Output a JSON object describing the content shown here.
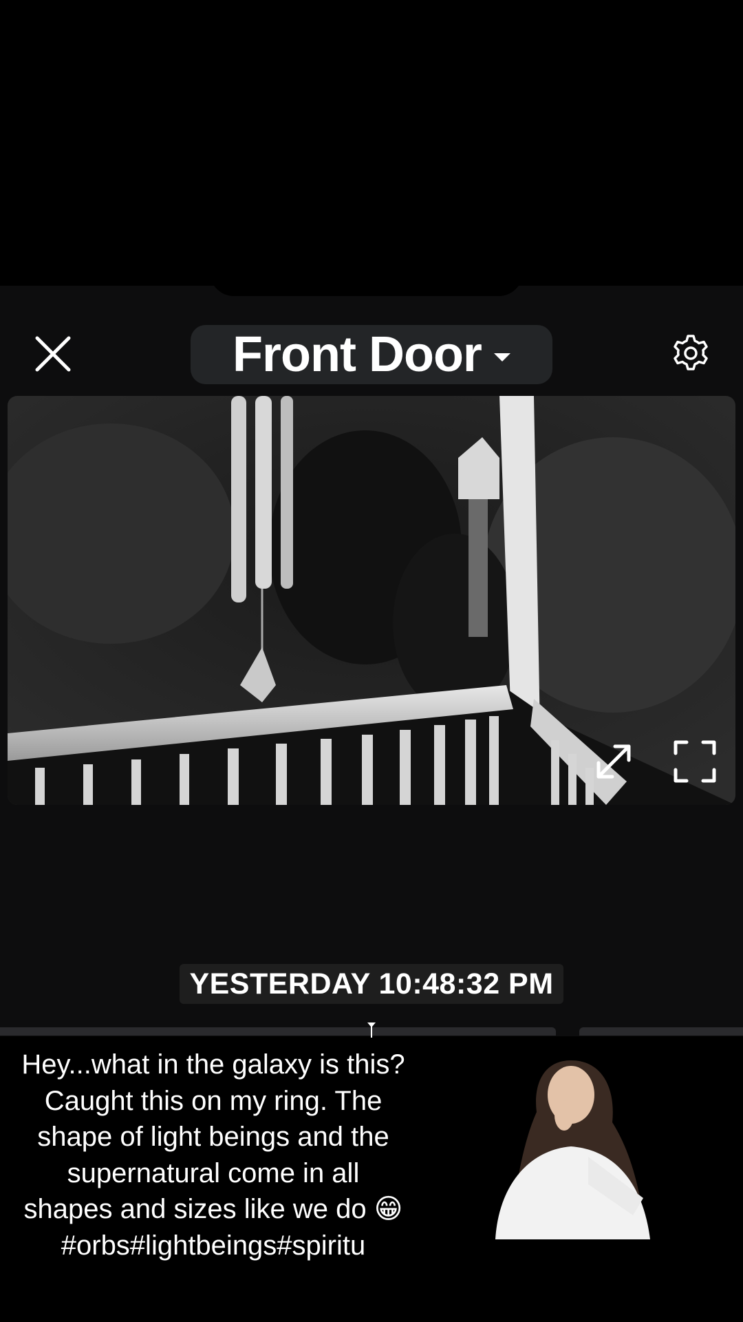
{
  "header": {
    "title": "Front Door",
    "close_icon": "close-icon",
    "dropdown_icon": "caret-down-icon",
    "settings_icon": "gear-icon"
  },
  "video": {
    "description_icon": "camera-feed",
    "expand_icon": "expand-diagonal-icon",
    "fullscreen_icon": "fullscreen-icon"
  },
  "timestamp": "YESTERDAY 10:48:32 PM",
  "caption": {
    "text": "Hey...what in the galaxy is this?Caught this on my ring. The shape of light beings and the supernatural come in all shapes and sizes like we do 😁 #orbs#lightbeings#spiritu"
  },
  "colors": {
    "background": "#000000",
    "panel": "#0d0d0e",
    "pill": "#232527",
    "text": "#ffffff"
  }
}
